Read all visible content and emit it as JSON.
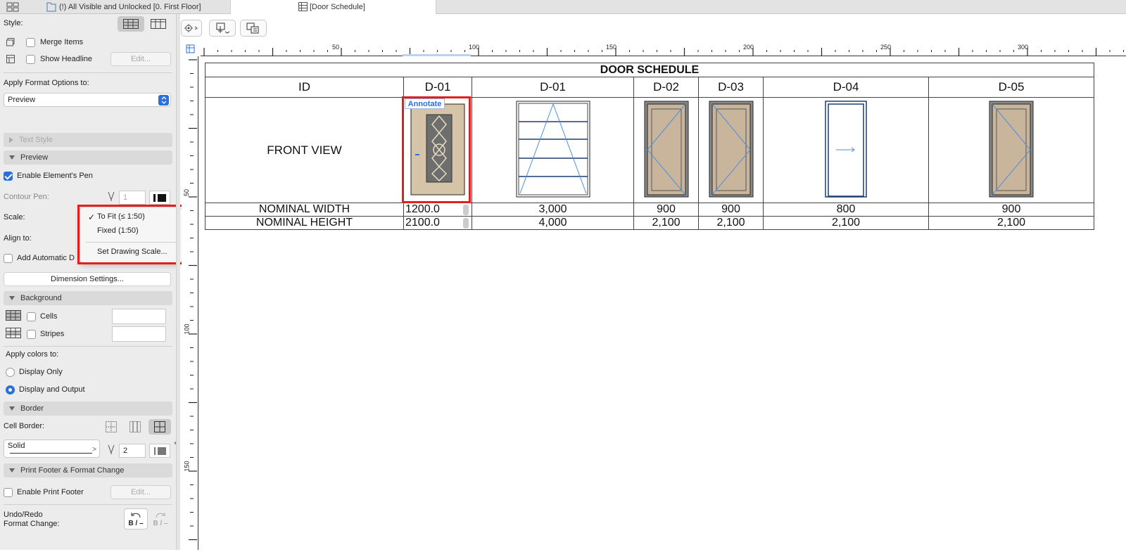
{
  "tabs": [
    {
      "label": "(!) All Visible and Unlocked [0. First Floor]",
      "icon": "floorplan-icon"
    },
    {
      "label": "[Door Schedule]",
      "icon": "schedule-table-icon"
    }
  ],
  "sidebar": {
    "style_label": "Style:",
    "merge_items": "Merge Items",
    "show_headline": "Show Headline",
    "edit_label": "Edit...",
    "apply_format_label": "Apply Format Options to:",
    "apply_format_value": "Preview",
    "text_style": "Text Style",
    "preview": "Preview",
    "enable_pen": "Enable Element's Pen",
    "contour_pen": "Contour Pen:",
    "contour_value": "1",
    "scale_label": "Scale:",
    "align_label": "Align to:",
    "add_auto": "Add Automatic D",
    "dimension_settings": "Dimension Settings...",
    "background": "Background",
    "cells": "Cells",
    "stripes": "Stripes",
    "apply_colors": "Apply colors to:",
    "display_only": "Display Only",
    "display_output": "Display and Output",
    "border": "Border",
    "cell_border": "Cell Border:",
    "line_type": "Solid",
    "pen_value": "2",
    "print_footer": "Print Footer & Format Change",
    "enable_footer": "Enable Print Footer",
    "undo_redo": "Undo/Redo\nFormat Change:",
    "undo_icon_text": "B / –",
    "redo_icon_text": "B / –"
  },
  "scale_menu": {
    "items": [
      "To Fit (≤ 1:50)",
      "Fixed (1:50)",
      "Set Drawing Scale..."
    ],
    "selected": "To Fit (≤ 1:50)"
  },
  "ruler": {
    "h_labels": [
      "50",
      "100",
      "150",
      "200",
      "250",
      "300"
    ],
    "v_labels": [
      "50",
      "100",
      "150"
    ]
  },
  "schedule": {
    "title": "DOOR SCHEDULE",
    "row_labels": [
      "ID",
      "FRONT VIEW",
      "NOMINAL WIDTH",
      "NOMINAL HEIGHT"
    ],
    "ids": [
      "D-01",
      "D-01",
      "D-02",
      "D-03",
      "D-04",
      "D-05"
    ],
    "widths": [
      "1200.0",
      "3,000",
      "900",
      "900",
      "800",
      "900"
    ],
    "heights": [
      "2100.0",
      "4,000",
      "2,100",
      "2,100",
      "2,100",
      "2,100"
    ],
    "annotate": "Annotate"
  },
  "colors": {
    "accent": "#2a6fdb",
    "highlight": "#e41d1d",
    "door_fill": "#c9b59c"
  }
}
